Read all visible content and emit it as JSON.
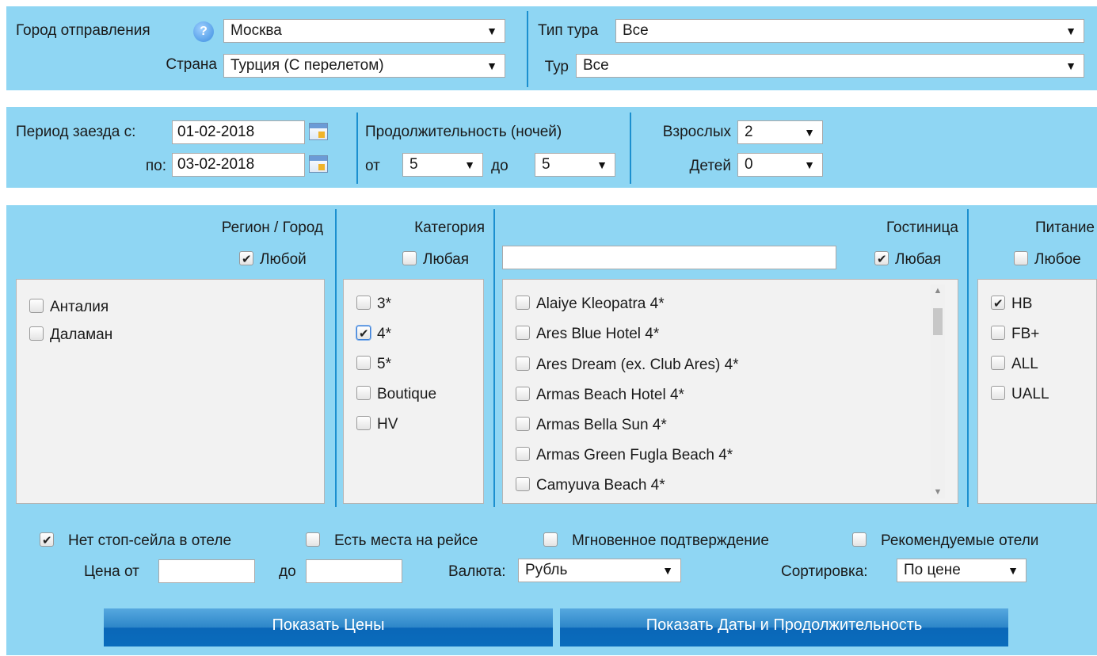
{
  "top": {
    "city_label": "Город отправления",
    "city_value": "Москва",
    "country_label": "Страна",
    "country_value": "Турция (С перелетом)",
    "tour_type_label": "Тип тура",
    "tour_type_value": "Все",
    "tour_label": "Тур",
    "tour_value": "Все"
  },
  "period": {
    "from_label": "Период заезда с:",
    "from_value": "01-02-2018",
    "to_label": "по:",
    "to_value": "03-02-2018"
  },
  "duration": {
    "label": "Продолжительность (ночей)",
    "from_label": "от",
    "from_value": "5",
    "to_label": "до",
    "to_value": "5"
  },
  "people": {
    "adults_label": "Взрослых",
    "adults_value": "2",
    "children_label": "Детей",
    "children_value": "0"
  },
  "region": {
    "header": "Регион / Город",
    "any_label": "Любой",
    "items": [
      "Анталия",
      "Даламан"
    ]
  },
  "category": {
    "header": "Категория",
    "any_label": "Любая",
    "items": [
      "3*",
      "4*",
      "5*",
      "Boutique",
      "HV"
    ]
  },
  "hotel": {
    "header": "Гостиница",
    "any_label": "Любая",
    "search_value": "",
    "items": [
      "Alaiye Kleopatra 4*",
      "Ares Blue Hotel 4*",
      "Ares Dream (ex. Club Ares) 4*",
      "Armas Beach Hotel 4*",
      "Armas Bella Sun 4*",
      "Armas Green Fugla Beach 4*",
      "Camyuva Beach 4*"
    ]
  },
  "meal": {
    "header": "Питание",
    "any_label": "Любое",
    "items": [
      "HB",
      "FB+",
      "ALL",
      "UALL"
    ]
  },
  "options": {
    "no_stop_sale": "Нет стоп-сейла в отеле",
    "seats_on_flight": "Есть места на рейсе",
    "instant_confirm": "Мгновенное подтверждение",
    "recommended": "Рекомендуемые отели"
  },
  "price": {
    "from_label": "Цена от",
    "from_value": "",
    "to_label": "до",
    "to_value": "",
    "currency_label": "Валюта:",
    "currency_value": "Рубль",
    "sort_label": "Сортировка:",
    "sort_value": "По цене"
  },
  "buttons": {
    "show_prices": "Показать Цены",
    "show_dates": "Показать Даты и Продолжительность"
  },
  "icons": {
    "dropdown_arrow": "▼",
    "help": "?"
  }
}
